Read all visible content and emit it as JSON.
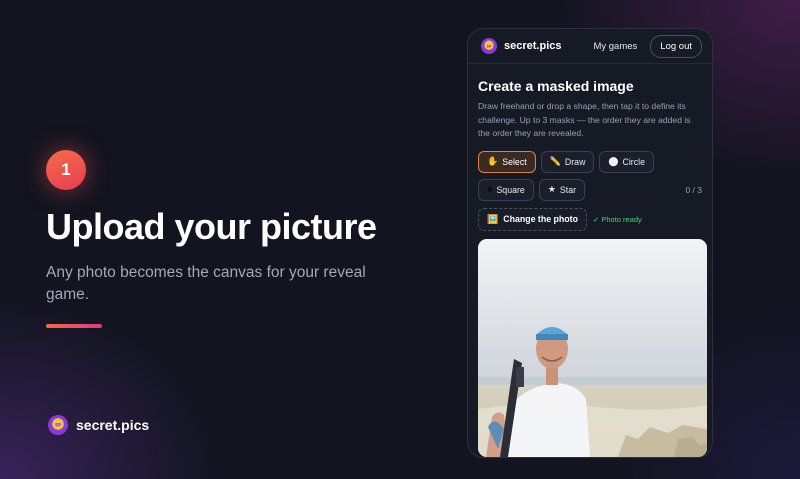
{
  "hero": {
    "step_number": "1",
    "title": "Upload your picture",
    "subtitle": "Any photo becomes the canvas for your reveal game."
  },
  "brand": {
    "name": "secret.pics",
    "logo_icon": "secret-pics-logo"
  },
  "phone": {
    "header": {
      "brand_name": "secret.pics",
      "my_games": "My games",
      "logout": "Log out"
    },
    "create": {
      "title": "Create a masked image",
      "description": "Draw freehand or drop a shape, then tap it to define its challenge. Up to 3 masks — the order they are added is the order they are revealed."
    },
    "tools": [
      {
        "label": "Select",
        "icon": "✋",
        "icon_name": "hand-icon",
        "active": true
      },
      {
        "label": "Draw",
        "icon": "✏️",
        "icon_name": "pencil-icon",
        "active": false
      },
      {
        "label": "Circle",
        "icon": "⬤",
        "icon_name": "circle-icon",
        "active": false
      },
      {
        "label": "Square",
        "icon": "■",
        "icon_name": "square-icon",
        "active": false
      },
      {
        "label": "Star",
        "icon": "★",
        "icon_name": "star-icon",
        "active": false
      }
    ],
    "mask_count": "0 / 3",
    "change_photo": {
      "label": "Change the photo",
      "icon": "🖼️"
    },
    "photo_ready": "✓ Photo ready"
  },
  "colors": {
    "accent_orange": "#f36a3d",
    "accent_pink": "#d93a8a",
    "ready_green": "#4bd07a",
    "background": "#12141f"
  }
}
